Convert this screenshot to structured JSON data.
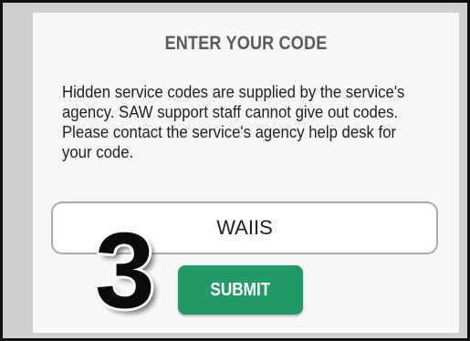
{
  "dialog": {
    "title": "ENTER YOUR CODE",
    "description": "Hidden service codes are supplied by the service's agency. SAW support staff cannot give out codes. Please contact the service's agency help desk for your code.",
    "code_value": "WAIIS",
    "submit_label": "SUBMIT"
  },
  "overlay": {
    "step_number": "3"
  },
  "colors": {
    "submit_button": "#229a68",
    "title_text": "#5a5a5a",
    "panel_background": "#f7f7f7"
  }
}
